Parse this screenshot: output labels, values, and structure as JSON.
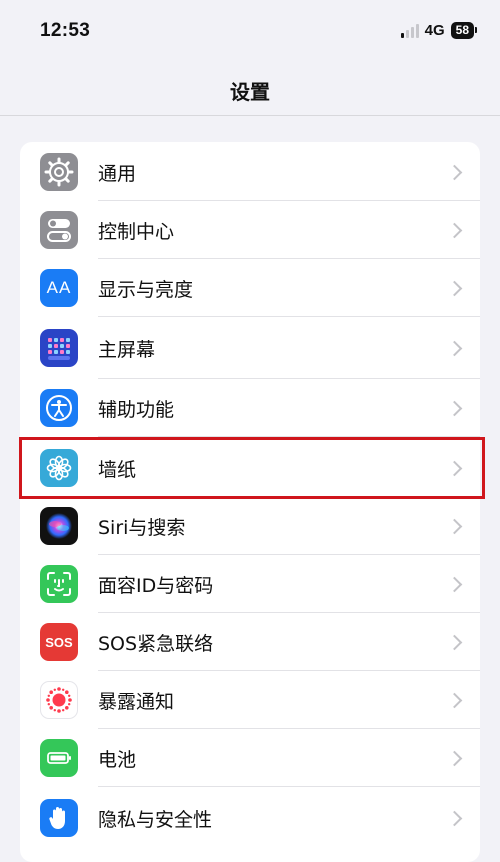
{
  "status_bar": {
    "time": "12:53",
    "network": "4G",
    "battery": "58"
  },
  "nav": {
    "title": "设置"
  },
  "settings": {
    "items": [
      {
        "label": "通用",
        "icon": "gear-icon",
        "color": "#8e8e93"
      },
      {
        "label": "控制中心",
        "icon": "toggles-icon",
        "color": "#8e8e93"
      },
      {
        "label": "显示与亮度",
        "icon": "text-size-icon",
        "color": "#1a7cf5"
      },
      {
        "label": "主屏幕",
        "icon": "home-screen-grid-icon",
        "color": "#2a44c6"
      },
      {
        "label": "辅助功能",
        "icon": "accessibility-person-icon",
        "color": "#1a7cf5"
      },
      {
        "label": "墙纸",
        "icon": "flower-icon",
        "color": "#36a9d8"
      },
      {
        "label": "Siri与搜索",
        "icon": "siri-orb-icon",
        "color": "#111111"
      },
      {
        "label": "面容ID与密码",
        "icon": "face-id-icon",
        "color": "#34c759"
      },
      {
        "label": "SOS紧急联络",
        "icon": "sos-icon",
        "color": "#e53935"
      },
      {
        "label": "暴露通知",
        "icon": "exposure-dots-icon",
        "color": "#ffffff"
      },
      {
        "label": "电池",
        "icon": "battery-icon",
        "color": "#34c759"
      },
      {
        "label": "隐私与安全性",
        "icon": "hand-icon",
        "color": "#1a7cf5"
      }
    ],
    "sos_text": "SOS",
    "text_size_text": "AA"
  },
  "highlight": {
    "color": "#d0161c",
    "target": "墙纸"
  }
}
